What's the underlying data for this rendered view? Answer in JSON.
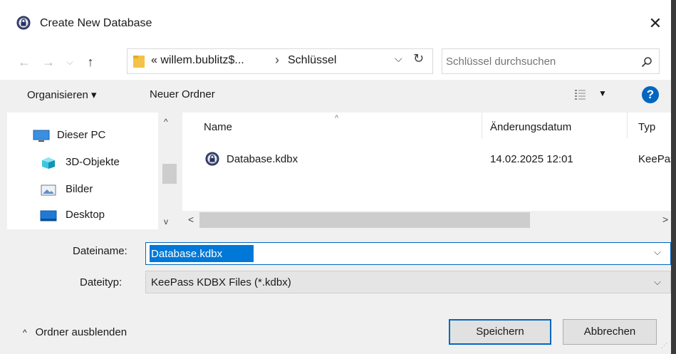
{
  "window": {
    "title": "Create New Database",
    "close_glyph": "✕"
  },
  "nav": {
    "back": "←",
    "forward": "→",
    "recent": "⌵",
    "up": "↑"
  },
  "address": {
    "prefix": "« willem.bublitz$...",
    "separator": "›",
    "folder": "Schlüssel",
    "dropdown": "⌵",
    "refresh": "↻"
  },
  "search": {
    "placeholder": "Schlüssel durchsuchen"
  },
  "toolbar": {
    "organize": "Organisieren ▾",
    "new_folder": "Neuer Ordner",
    "view_dropdown": "▼",
    "help": "?"
  },
  "sidebar": {
    "items": [
      {
        "label": "Dieser PC",
        "icon": "computer-icon"
      },
      {
        "label": "3D-Objekte",
        "icon": "cube-icon"
      },
      {
        "label": "Bilder",
        "icon": "pictures-icon"
      },
      {
        "label": "Desktop",
        "icon": "desktop-icon"
      }
    ],
    "scroll_up": "^",
    "scroll_down": "v"
  },
  "files": {
    "columns": {
      "name": "Name",
      "date": "Änderungsdatum",
      "type": "Typ"
    },
    "sort_arrow": "^",
    "rows": [
      {
        "name": "Database.kdbx",
        "date": "14.02.2025 12:01",
        "type": "KeePass"
      }
    ],
    "scroll_left": "<",
    "scroll_right": ">"
  },
  "form": {
    "filename_label": "Dateiname:",
    "filename_value": "Database.kdbx",
    "filetype_label": "Dateityp:",
    "filetype_value": "KeePass KDBX Files (*.kdbx)",
    "dropdown_glyph": "⌵"
  },
  "footer": {
    "hide_folders_chevron": "^",
    "hide_folders": "Ordner ausblenden",
    "save": "Speichern",
    "cancel": "Abbrechen",
    "grip": "⋰"
  },
  "colors": {
    "accent": "#0067c0",
    "selection": "#0078d7",
    "folder": "#f3c246"
  }
}
